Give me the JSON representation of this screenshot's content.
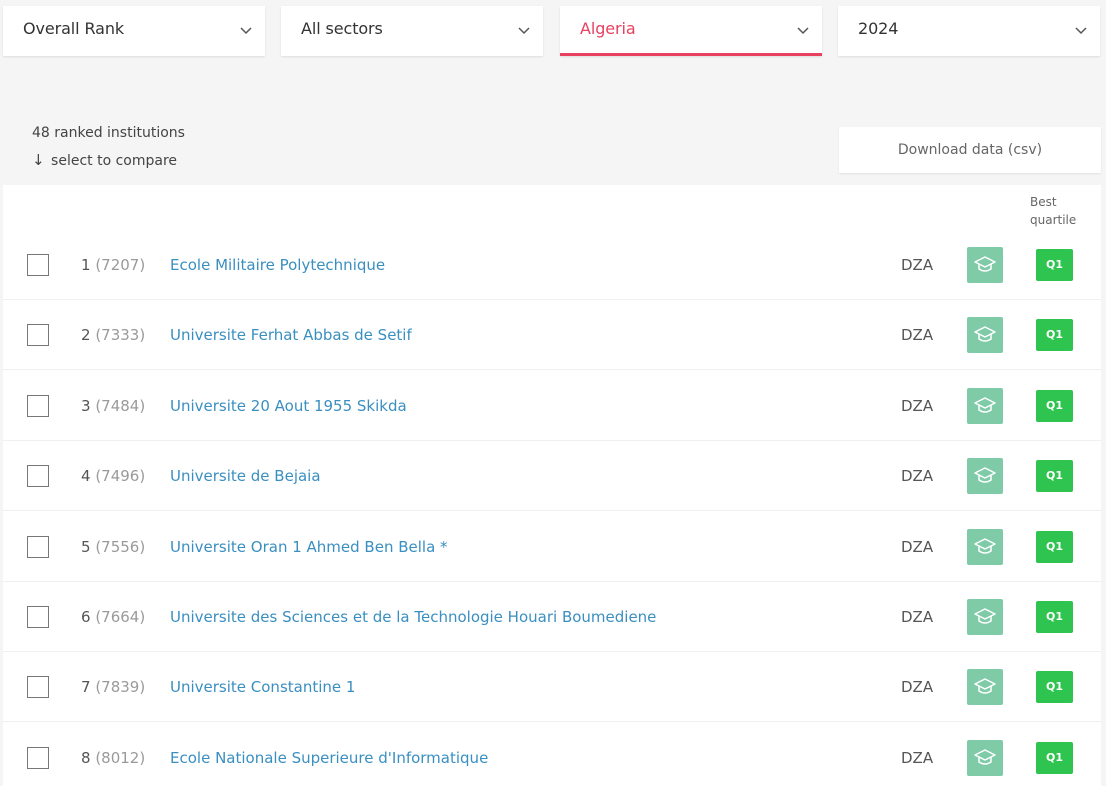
{
  "filters": {
    "rank_type": "Overall Rank",
    "sector": "All sectors",
    "country": "Algeria",
    "year": "2024"
  },
  "summary": {
    "count_text": "48 ranked institutions",
    "compare_arrow": "↓",
    "compare_text": "select to compare"
  },
  "download_label": "Download data (csv)",
  "table": {
    "best_quartile_header_line1": "Best",
    "best_quartile_header_line2": "quartile",
    "rows": [
      {
        "rank": "1",
        "score": "(7207)",
        "name": "Ecole Militaire Polytechnique",
        "country": "DZA",
        "quartile": "Q1"
      },
      {
        "rank": "2",
        "score": "(7333)",
        "name": "Universite Ferhat Abbas de Setif",
        "country": "DZA",
        "quartile": "Q1"
      },
      {
        "rank": "3",
        "score": "(7484)",
        "name": "Universite 20 Aout 1955 Skikda",
        "country": "DZA",
        "quartile": "Q1"
      },
      {
        "rank": "4",
        "score": "(7496)",
        "name": "Universite de Bejaia",
        "country": "DZA",
        "quartile": "Q1"
      },
      {
        "rank": "5",
        "score": "(7556)",
        "name": "Universite Oran 1 Ahmed Ben Bella *",
        "country": "DZA",
        "quartile": "Q1"
      },
      {
        "rank": "6",
        "score": "(7664)",
        "name": "Universite des Sciences et de la Technologie Houari Boumediene",
        "country": "DZA",
        "quartile": "Q1"
      },
      {
        "rank": "7",
        "score": "(7839)",
        "name": "Universite Constantine 1",
        "country": "DZA",
        "quartile": "Q1"
      },
      {
        "rank": "8",
        "score": "(8012)",
        "name": "Ecole Nationale Superieure d'Informatique",
        "country": "DZA",
        "quartile": "Q1"
      }
    ]
  },
  "icons": {
    "chevron": "chevron-down-icon",
    "sector": "graduation-cap-icon"
  },
  "colors": {
    "accent": "#e8415f",
    "link": "#3a8fc1",
    "sector_badge": "#7fcba8",
    "quartile_badge": "#2ec44f"
  }
}
